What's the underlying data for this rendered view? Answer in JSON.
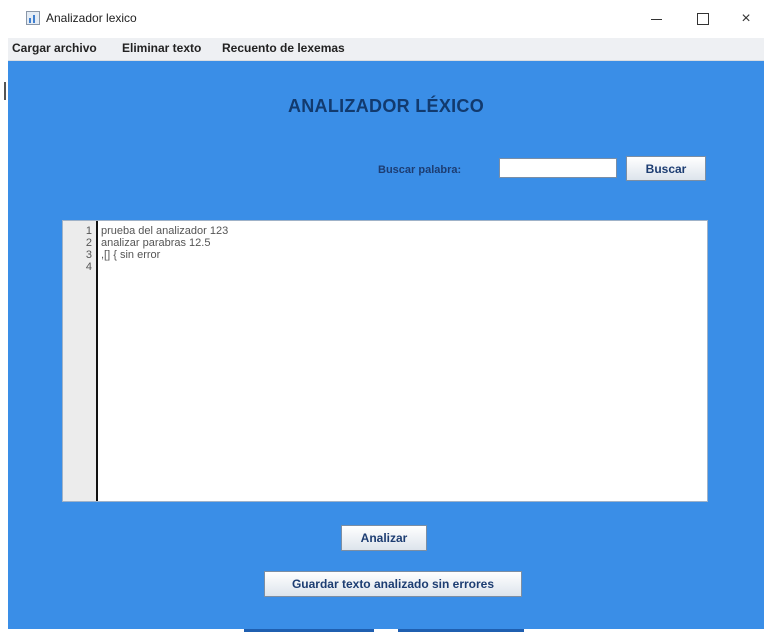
{
  "window": {
    "title": "Analizador lexico",
    "controls": {
      "minimize": "",
      "maximize": "",
      "close": "×"
    }
  },
  "menu": {
    "items": [
      "Cargar archivo",
      "Eliminar texto",
      "Recuento de lexemas"
    ]
  },
  "main": {
    "heading": "ANALIZADOR LÉXICO",
    "search": {
      "label": "Buscar palabra:",
      "value": "",
      "button": "Buscar"
    },
    "editor": {
      "line_numbers": [
        "1",
        "2",
        "3",
        "4"
      ],
      "lines": [
        "prueba del analizador 123",
        "analizar parabras 12.5",
        ",[] { sin error",
        ""
      ]
    },
    "buttons": {
      "analyze": "Analizar",
      "save": "Guardar texto analizado sin errores"
    }
  },
  "colors": {
    "content_background": "#3a8ee7",
    "heading": "#123a6e",
    "label": "#1d3d72"
  }
}
